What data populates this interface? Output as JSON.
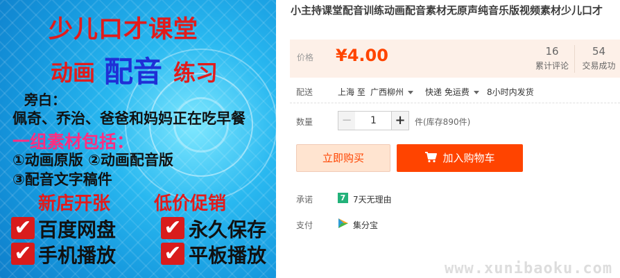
{
  "product_image": {
    "title_line1": "少儿口才课堂",
    "title_line2_a": "动画",
    "title_line2_b": "配音",
    "title_line2_c": "练习",
    "narration_label": "旁白：",
    "narration_text": "佩奇、乔治、爸爸和妈妈正在吃早餐",
    "package_heading": "一组素材包括：",
    "items_line1": "①动画原版  ②动画配音版",
    "items_line2": "③配音文字稿件",
    "promo_left": "新店开张",
    "promo_right": "低价促销",
    "features": [
      "百度网盘",
      "永久保存",
      "手机播放",
      "平板播放"
    ],
    "check_mark": "✔"
  },
  "product": {
    "title": "小主持课堂配音训练动画配音素材无原声纯音乐版视频素材少儿口才"
  },
  "price": {
    "label": "价格",
    "value": "¥4.00",
    "color": "#ff4400"
  },
  "stats": [
    {
      "value": "16",
      "label": "累计评论"
    },
    {
      "value": "54",
      "label": "交易成功"
    }
  ],
  "shipping": {
    "label": "配送",
    "from": "上海 至",
    "to": "广西柳州",
    "method": "快递 免运费",
    "dispatch": "8小时内发货"
  },
  "quantity": {
    "label": "数量",
    "value": "1",
    "minus": "−",
    "plus": "+",
    "stock": "件(库存890件)"
  },
  "actions": {
    "buy_now": "立即购买",
    "add_to_cart": "加入购物车"
  },
  "promise": {
    "label": "承诺",
    "badge": "7",
    "text": "7天无理由",
    "badge_color": "#23b27a"
  },
  "payment": {
    "label": "支付",
    "icon": "jifenbao-icon",
    "text": "集分宝"
  },
  "watermark": "www.xunibaoku.com"
}
